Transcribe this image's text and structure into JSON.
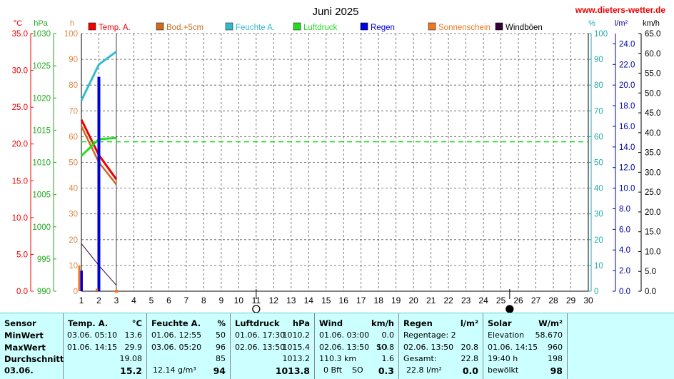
{
  "title": "Juni 2025",
  "website": "www.dieters-wetter.de",
  "colors": {
    "temp": "#ee0000",
    "soil": "#cc6a1e",
    "hum": "#33bbcc",
    "press": "#22dd22",
    "rain": "#0000dd",
    "sun": "#ee7722",
    "gust": "#330033",
    "c_axis": "#ee0000",
    "hpa_axis": "#22aa22",
    "h_axis": "#dd8844",
    "pct_axis": "#22aaaa",
    "lm2_axis": "#0000aa",
    "kmh_axis": "#000000",
    "panel_bg": "#ccffff"
  },
  "axis_units": {
    "celsius": "°C",
    "hpa": "hPa",
    "hours": "h",
    "percent": "%",
    "lm2": "l/m²",
    "kmh": "km/h"
  },
  "chart_data": {
    "type": "line",
    "title": "Juni 2025",
    "x": [
      1,
      2,
      3
    ],
    "xlim": [
      1,
      30
    ],
    "xticks": [
      1,
      2,
      3,
      4,
      5,
      6,
      7,
      8,
      9,
      10,
      11,
      12,
      13,
      14,
      15,
      16,
      17,
      18,
      19,
      20,
      21,
      22,
      23,
      24,
      25,
      26,
      27,
      28,
      29,
      30
    ],
    "axes": {
      "celsius": {
        "range": [
          0,
          35
        ],
        "ticks": [
          "0.0",
          "5.0",
          "10.0",
          "15.0",
          "20.0",
          "25.0",
          "30.0",
          "35.0"
        ]
      },
      "hpa": {
        "range": [
          990,
          1030
        ],
        "ticks": [
          "990",
          "995",
          "1000",
          "1005",
          "1010",
          "1015",
          "1020",
          "1025",
          "1030"
        ]
      },
      "hours": {
        "range": [
          0,
          100
        ],
        "ticks": [
          "0",
          "10",
          "20",
          "30",
          "40",
          "50",
          "60",
          "70",
          "80",
          "90",
          "100"
        ]
      },
      "percent": {
        "range": [
          0,
          100
        ],
        "ticks": [
          "0",
          "10",
          "20",
          "30",
          "40",
          "50",
          "60",
          "70",
          "80",
          "90",
          "100"
        ]
      },
      "lm2": {
        "range": [
          0,
          25
        ],
        "ticks": [
          "0.0",
          "2.0",
          "4.0",
          "6.0",
          "8.0",
          "10.0",
          "12.0",
          "14.0",
          "16.0",
          "18.0",
          "20.0",
          "22.0",
          "24.0"
        ]
      },
      "kmh": {
        "range": [
          0,
          65
        ],
        "ticks": [
          "0.0",
          "5.0",
          "10.0",
          "15.0",
          "20.0",
          "25.0",
          "30.0",
          "35.0",
          "40.0",
          "45.0",
          "50.0",
          "55.0",
          "60.0",
          "65.0"
        ]
      }
    },
    "series": [
      {
        "name": "Temp. A.",
        "key": "temp",
        "axis": "celsius",
        "kind": "line",
        "x": [
          1,
          2,
          3
        ],
        "values": [
          23.3,
          18.5,
          15.2
        ]
      },
      {
        "name": "Bod.+5cm",
        "key": "soil",
        "axis": "celsius",
        "kind": "line",
        "x": [
          1,
          2,
          3
        ],
        "values": [
          22.4,
          17.5,
          14.5
        ]
      },
      {
        "name": "Feuchte A.",
        "key": "hum",
        "axis": "percent",
        "kind": "line",
        "x": [
          1,
          2,
          3
        ],
        "values": [
          74,
          88,
          93
        ]
      },
      {
        "name": "Luftdruck",
        "key": "press",
        "axis": "hpa",
        "kind": "line",
        "x": [
          1,
          2,
          3
        ],
        "values": [
          1011.0,
          1013.6,
          1013.8
        ]
      },
      {
        "name": "Luftdruck Mittel",
        "key": "press",
        "axis": "hpa",
        "kind": "dashed",
        "x": [
          1,
          30
        ],
        "values": [
          1013.2,
          1013.2
        ]
      },
      {
        "name": "Regen",
        "key": "rain",
        "axis": "lm2",
        "kind": "bar",
        "x": [
          1,
          2,
          3
        ],
        "values": [
          2.0,
          20.8,
          0.0
        ]
      },
      {
        "name": "Sonnenschein",
        "key": "sun",
        "axis": "hours",
        "kind": "bar",
        "x": [
          1,
          2,
          3
        ],
        "values": [
          10,
          1,
          0
        ]
      },
      {
        "name": "Windböen",
        "key": "gust",
        "axis": "kmh",
        "kind": "line",
        "x": [
          1,
          2,
          3
        ],
        "values": [
          12.0,
          6.5,
          1.5
        ]
      }
    ],
    "moon_phases": [
      {
        "x": 11.0,
        "phase": "full"
      },
      {
        "x": 25.5,
        "phase": "new"
      }
    ],
    "grid": true,
    "legend_position": "top"
  },
  "panel": {
    "rows": [
      "Sensor",
      "MinWert",
      "MaxWert",
      "Durchschnitt",
      "03.06."
    ],
    "temp": {
      "title": "Temp. A.",
      "unit": "°C",
      "min_dt": "03.06.  05:10",
      "min": "13.6",
      "max_dt": "01.06.  14:15",
      "max": "29.9",
      "avg": "19.08",
      "current": "15.2"
    },
    "hum": {
      "title": "Feuchte A.",
      "unit": "%",
      "min_dt": "01.06.  12:55",
      "min": "50",
      "max_dt": "03.06.  05:20",
      "max": "96",
      "avg": "85",
      "abs": "12.14 g/m³",
      "current": "94"
    },
    "press": {
      "title": "Luftdruck",
      "unit": "hPa",
      "min_dt": "01.06.  17:30",
      "min": "1010.2",
      "max_dt": "02.06.  13:50",
      "max": "1015.4",
      "avg": "1013.2",
      "current": "1013.8"
    },
    "wind": {
      "title": "Wind",
      "unit": "km/h",
      "min_dt": "01.06.  03:00",
      "min": "0.0",
      "max_dt": "02.06.  13:50",
      "max_dir": "SO",
      "max": "10.8",
      "dist": "110.3 km",
      "avg": "1.6",
      "bft": "0 Bft",
      "dir": "SO",
      "current": "0.3"
    },
    "rain": {
      "title": "Regen",
      "unit": "l/m²",
      "days": "Regentage: 2",
      "max_dt": "02.06.  13:50",
      "max": "20.8",
      "total_label": "Gesamt:",
      "total": "22.8",
      "today_total": "22.8 l/m²",
      "current": "0.0"
    },
    "solar": {
      "title": "Solar",
      "unit": "W/m²",
      "elev_label": "Elevation",
      "elev": "58.670",
      "max_dt": "01.06.  14:15",
      "max": "960",
      "time": "19:40 h",
      "time_val": "198",
      "sky": "bewölkt",
      "current": "98"
    }
  }
}
